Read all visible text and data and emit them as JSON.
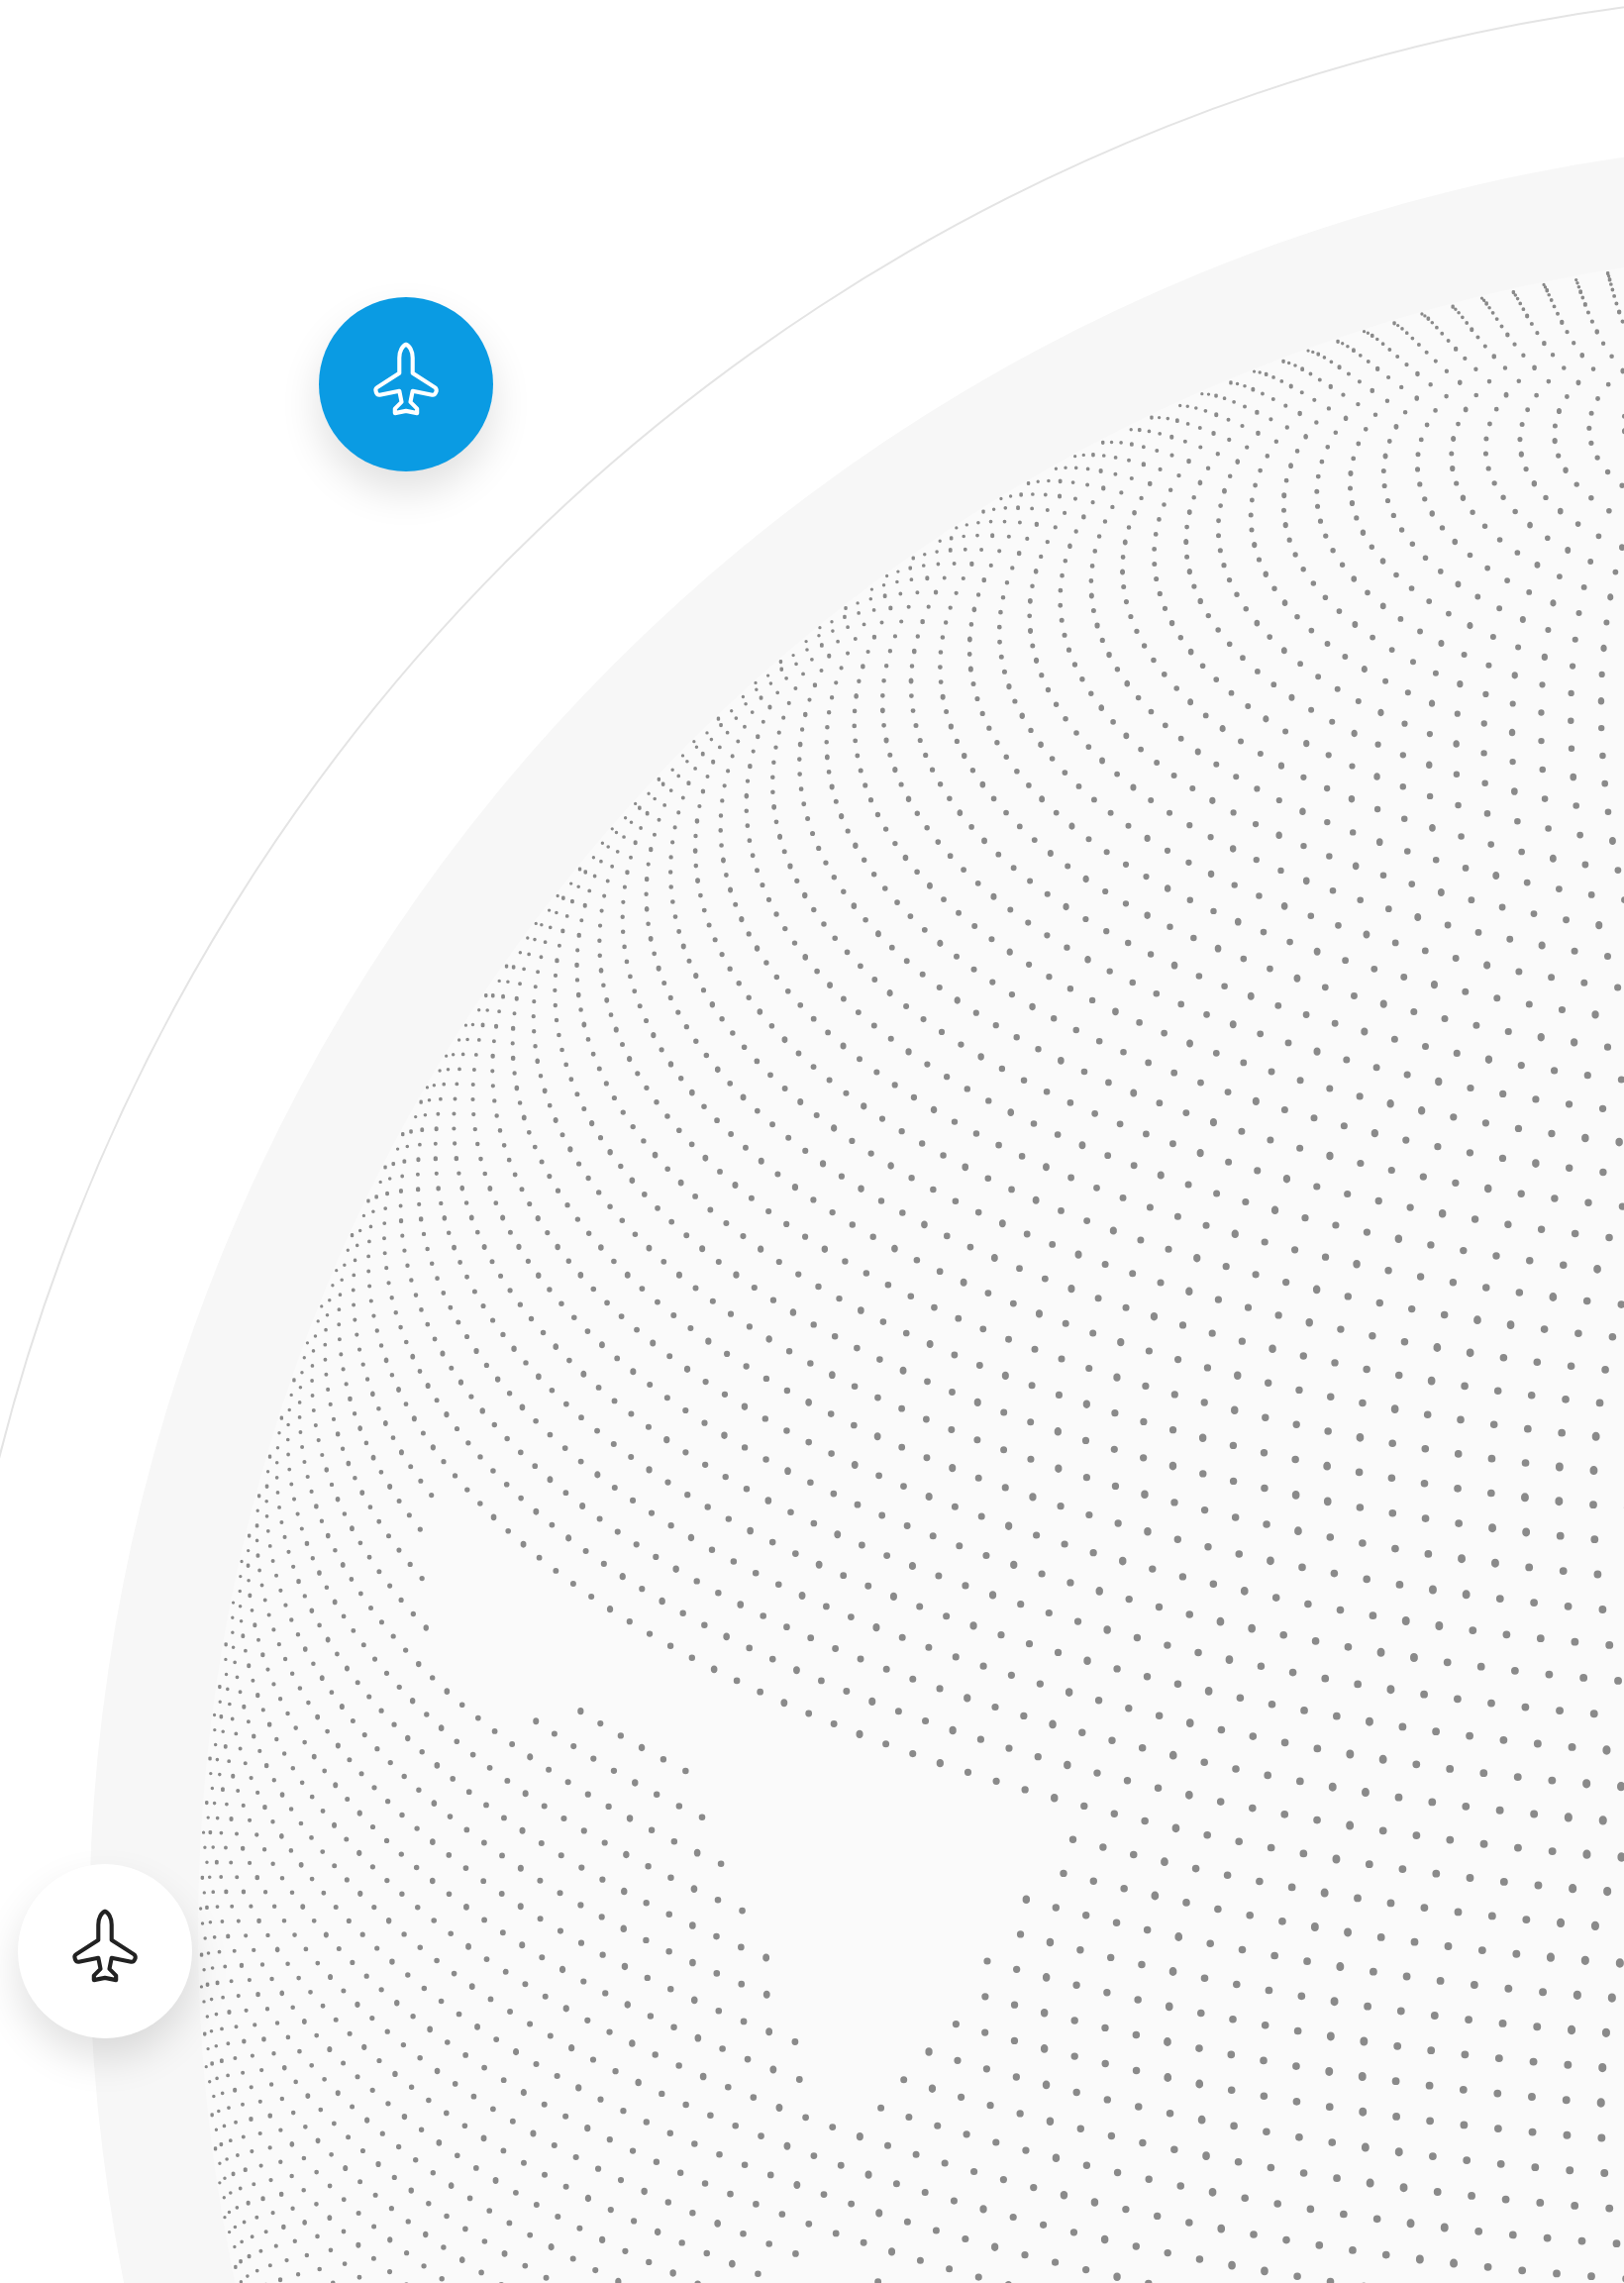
{
  "plane_badges": [
    {
      "selected": true
    },
    {
      "selected": false
    }
  ]
}
